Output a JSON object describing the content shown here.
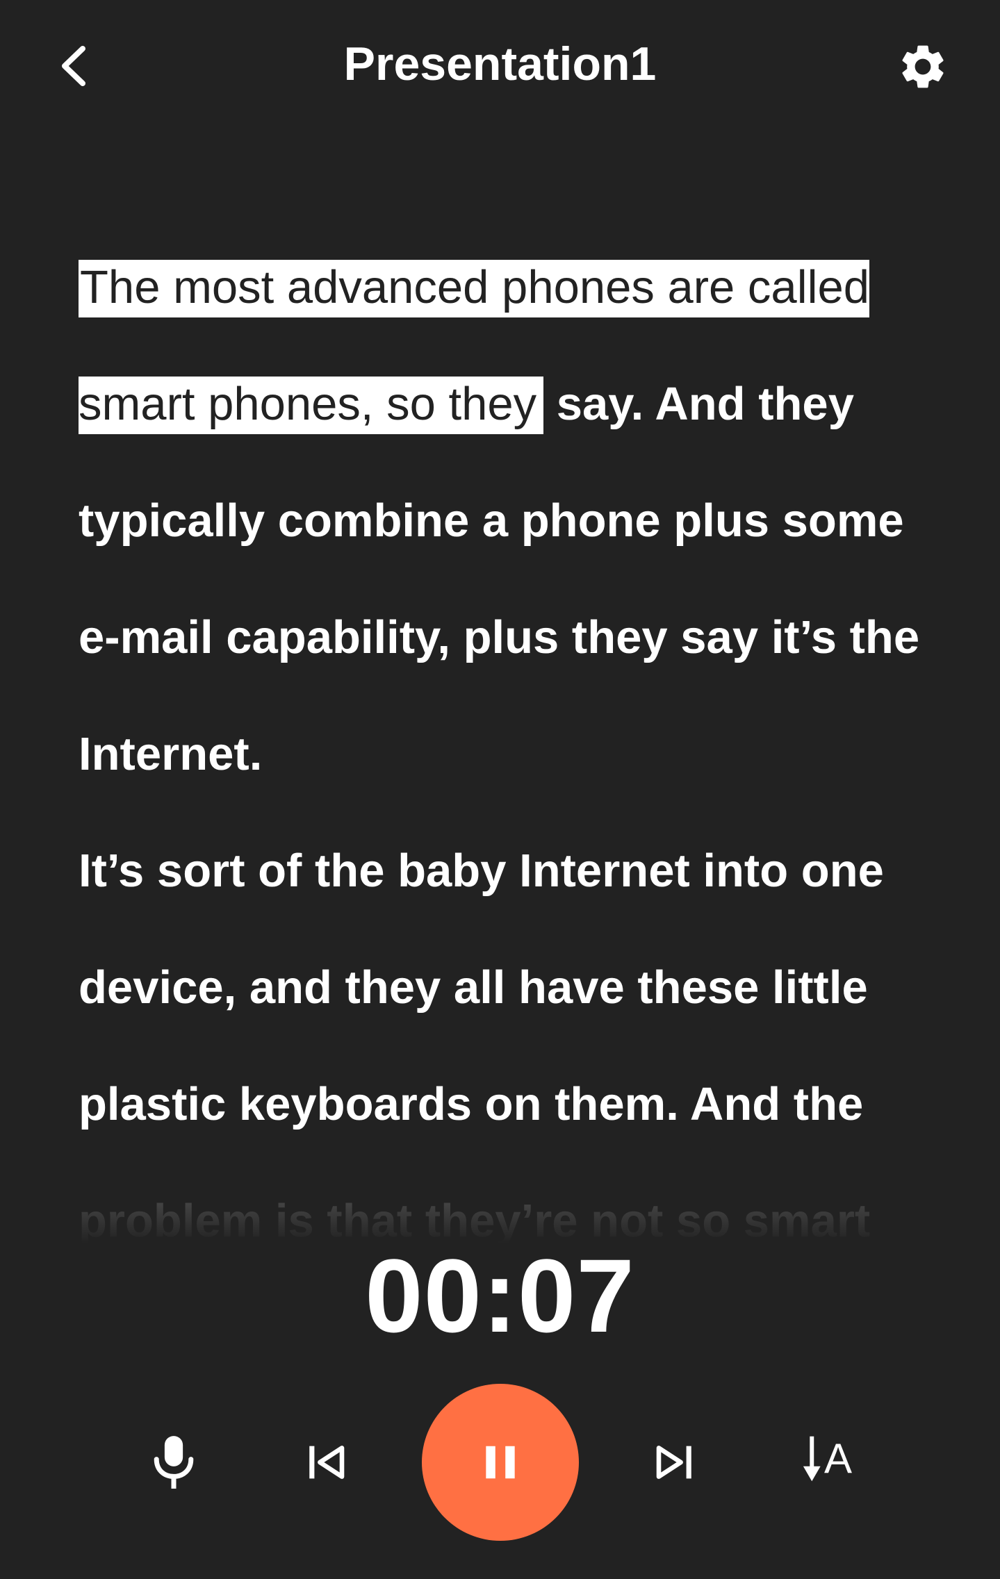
{
  "header": {
    "title": "Presentation1",
    "back_icon": "chevron-left-icon",
    "settings_icon": "gear-icon"
  },
  "script": {
    "highlighted_text": "The most advanced phones are called smart phones, so they",
    "paragraphs": [
      " say. And they typically combine a phone plus some e-mail capability, plus they say it’s the Internet.",
      "It’s sort of the baby Internet into one device, and they all have these little plastic keyboards on them. And the problem is that they’re not so smart"
    ]
  },
  "timer": {
    "elapsed": "00:07"
  },
  "controls": {
    "mic_icon": "microphone-icon",
    "prev_icon": "skip-previous-icon",
    "pause_icon": "pause-icon",
    "next_icon": "skip-next-icon",
    "font_size_label": "A",
    "font_size_icon": "text-size-icon"
  },
  "colors": {
    "background": "#222222",
    "accent": "#FF7043",
    "text": "#FFFFFF",
    "highlight_bg": "#FFFFFF",
    "highlight_text": "#222222"
  }
}
